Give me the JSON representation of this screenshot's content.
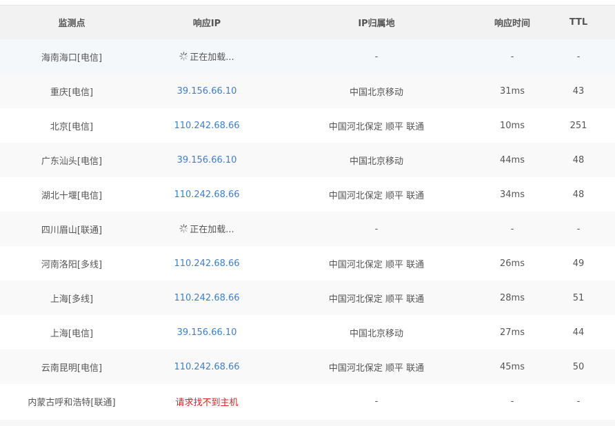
{
  "headers": {
    "monitor": "监测点",
    "ip": "响应IP",
    "location": "IP归属地",
    "time": "响应时间",
    "ttl": "TTL"
  },
  "rows": [
    {
      "monitor": "海南海口[电信]",
      "ip": "正在加载...",
      "ip_state": "loading",
      "location": "-",
      "time": "-",
      "ttl": "-"
    },
    {
      "monitor": "重庆[电信]",
      "ip": "39.156.66.10",
      "ip_state": "ok",
      "location": "中国北京移动",
      "time": "31ms",
      "ttl": "43"
    },
    {
      "monitor": "北京[电信]",
      "ip": "110.242.68.66",
      "ip_state": "ok",
      "location": "中国河北保定 顺平 联通",
      "time": "10ms",
      "ttl": "251"
    },
    {
      "monitor": "广东汕头[电信]",
      "ip": "39.156.66.10",
      "ip_state": "ok",
      "location": "中国北京移动",
      "time": "44ms",
      "ttl": "48"
    },
    {
      "monitor": "湖北十堰[电信]",
      "ip": "110.242.68.66",
      "ip_state": "ok",
      "location": "中国河北保定 顺平 联通",
      "time": "34ms",
      "ttl": "48"
    },
    {
      "monitor": "四川眉山[联通]",
      "ip": "正在加载...",
      "ip_state": "loading",
      "location": "-",
      "time": "-",
      "ttl": "-"
    },
    {
      "monitor": "河南洛阳[多线]",
      "ip": "110.242.68.66",
      "ip_state": "ok",
      "location": "中国河北保定 顺平 联通",
      "time": "26ms",
      "ttl": "49"
    },
    {
      "monitor": "上海[多线]",
      "ip": "110.242.68.66",
      "ip_state": "ok",
      "location": "中国河北保定 顺平 联通",
      "time": "28ms",
      "ttl": "51"
    },
    {
      "monitor": "上海[电信]",
      "ip": "39.156.66.10",
      "ip_state": "ok",
      "location": "中国北京移动",
      "time": "27ms",
      "ttl": "44"
    },
    {
      "monitor": "云南昆明[电信]",
      "ip": "110.242.68.66",
      "ip_state": "ok",
      "location": "中国河北保定 顺平 联通",
      "time": "45ms",
      "ttl": "50"
    },
    {
      "monitor": "内蒙古呼和浩特[联通]",
      "ip": "请求找不到主机",
      "ip_state": "error",
      "location": "-",
      "time": "-",
      "ttl": "-"
    }
  ],
  "colors": {
    "ip_link": "#3b7fd0",
    "error": "#e02020",
    "header_bg": "#f2f2f2",
    "row_alt_bg": "#f9f9f9"
  },
  "icons": {
    "loading": "loading-spinner-icon"
  }
}
